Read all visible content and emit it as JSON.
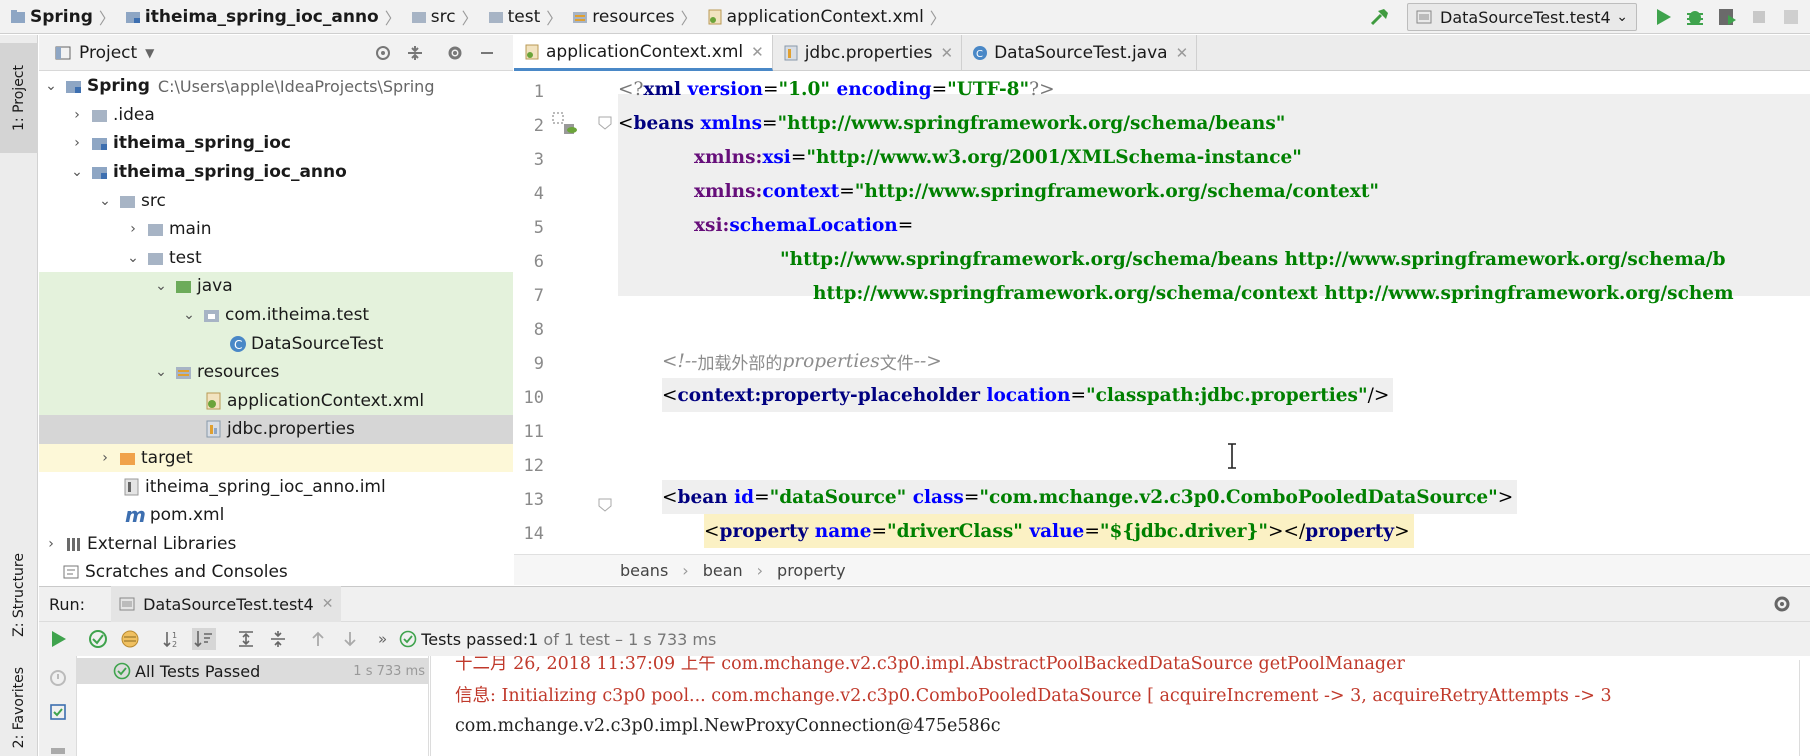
{
  "navbar": {
    "crumbs": [
      "Spring",
      "itheima_spring_ioc_anno",
      "src",
      "test",
      "resources",
      "applicationContext.xml"
    ],
    "run_config": "DataSourceTest.test4"
  },
  "left_strip": {
    "project_tab": "1: Project",
    "structure_tab": "Z: Structure",
    "favorites_tab": "2: Favorites"
  },
  "project_panel": {
    "title": "Project",
    "tree": [
      {
        "label": "Spring",
        "suffix": "C:\\Users\\apple\\IdeaProjects\\Spring",
        "bold": true
      },
      {
        "label": ".idea"
      },
      {
        "label": "itheima_spring_ioc",
        "bold": true
      },
      {
        "label": "itheima_spring_ioc_anno",
        "bold": true
      },
      {
        "label": "src"
      },
      {
        "label": "main"
      },
      {
        "label": "test"
      },
      {
        "label": "java"
      },
      {
        "label": "com.itheima.test"
      },
      {
        "label": "DataSourceTest"
      },
      {
        "label": "resources"
      },
      {
        "label": "applicationContext.xml"
      },
      {
        "label": "jdbc.properties"
      },
      {
        "label": "target"
      },
      {
        "label": "itheima_spring_ioc_anno.iml"
      },
      {
        "label": "pom.xml"
      },
      {
        "label": "External Libraries"
      },
      {
        "label": "Scratches and Consoles"
      }
    ]
  },
  "editor": {
    "tabs": [
      "applicationContext.xml",
      "jdbc.properties",
      "DataSourceTest.java"
    ],
    "line_numbers": [
      "1",
      "2",
      "3",
      "4",
      "5",
      "6",
      "7",
      "8",
      "9",
      "10",
      "11",
      "12",
      "13",
      "14"
    ],
    "breadcrumbs": [
      "beans",
      "bean",
      "property"
    ]
  },
  "code": {
    "l1": [
      "<?",
      "xml",
      " version",
      "=",
      "\"1.0\"",
      " encoding",
      "=",
      "\"UTF-8\"",
      "?>"
    ],
    "l2": [
      "<",
      "beans",
      " xmlns",
      "=",
      "\"http://www.springframework.org/schema/beans\""
    ],
    "l3": [
      "xmlns:",
      "xsi",
      "=",
      "\"http://www.w3.org/2001/XMLSchema-instance\""
    ],
    "l4": [
      "xmlns:",
      "context",
      "=",
      "\"http://www.springframework.org/schema/context\""
    ],
    "l5": [
      "xsi:",
      "schemaLocation",
      "="
    ],
    "l6": "\"http://www.springframework.org/schema/beans http://www.springframework.org/schema/b",
    "l7": "http://www.springframework.org/schema/context http://www.springframework.org/schem",
    "l9": [
      "<!--",
      "加载外部的",
      "properties",
      "文件",
      "-->"
    ],
    "l10": [
      "<",
      "context:property-placeholder",
      " location",
      "=",
      "\"classpath:jdbc.properties\"",
      "/>"
    ],
    "l13": [
      "<",
      "bean",
      " id",
      "=",
      "\"dataSource\"",
      " class",
      "=",
      "\"com.mchange.v2.c3p0.ComboPooledDataSource\"",
      ">"
    ],
    "l14": [
      "<",
      "property",
      " name",
      "=",
      "\"driverClass\"",
      " value",
      "=",
      "\"${jdbc.driver}\"",
      "></",
      "property",
      ">"
    ]
  },
  "run_panel": {
    "label": "Run:",
    "tab": "DataSourceTest.test4",
    "status_prefix": "Tests passed: ",
    "status_count": "1",
    "status_suffix": " of 1 test – 1 s 733 ms",
    "tree_item": "All Tests Passed",
    "tree_time": "1 s 733 ms",
    "console": [
      "十二月 26, 2018 11:37:09 上午 com.mchange.v2.c3p0.impl.AbstractPoolBackedDataSource getPoolManager",
      "信息: Initializing c3p0 pool... com.mchange.v2.c3p0.ComboPooledDataSource [ acquireIncrement -> 3, acquireRetryAttempts -> 3",
      "com.mchange.v2.c3p0.impl.NewProxyConnection@475e586c"
    ]
  },
  "colors": {
    "accent": "#4a88c7",
    "run_green": "#3fa34d",
    "folder_blue": "#8ea6c4",
    "test_folder_green": "#e4f2dc"
  }
}
